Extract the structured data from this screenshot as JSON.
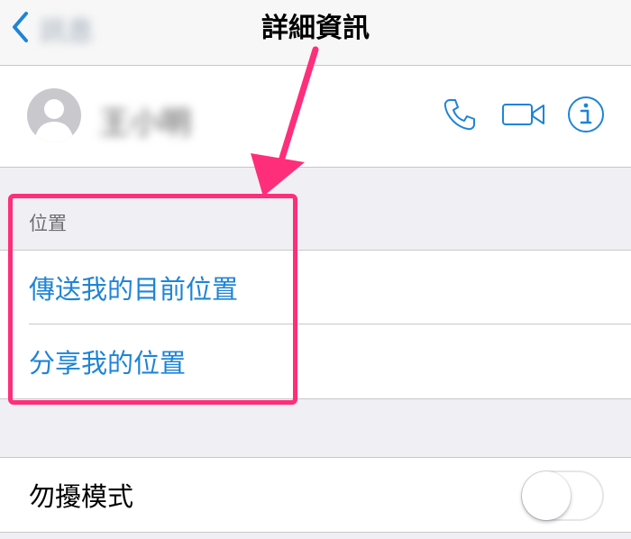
{
  "nav": {
    "back_label": "訊息",
    "title": "詳細資訊"
  },
  "contact": {
    "name": "王小明",
    "actions": [
      "phone-icon",
      "video-icon",
      "info-icon"
    ]
  },
  "location": {
    "header": "位置",
    "items": [
      "傳送我的目前位置",
      "分享我的位置"
    ]
  },
  "do_not_disturb": {
    "label": "勿擾模式",
    "enabled": false
  },
  "colors": {
    "accent": "#1f84d6",
    "annotation": "#ff2e7a",
    "background": "#efeff4"
  }
}
